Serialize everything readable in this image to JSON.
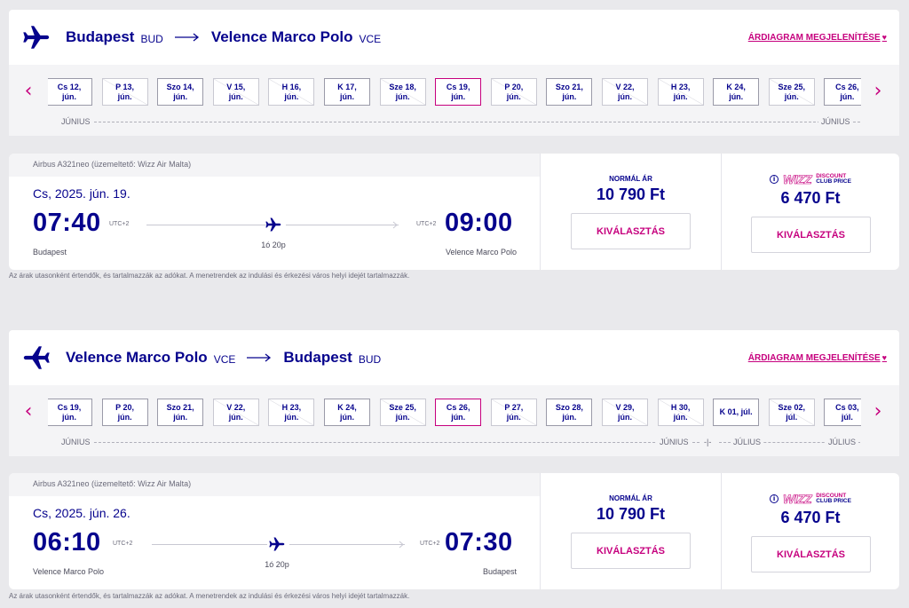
{
  "segments": [
    {
      "origin": "Budapest",
      "origin_code": "BUD",
      "destination": "Velence Marco Polo",
      "destination_code": "VCE",
      "price_chart_link": "ÁRDIAGRAM MEGJELENÍTÉSE",
      "dates": [
        {
          "day": "Cs 12,",
          "month": "jún.",
          "available": true
        },
        {
          "day": "P 13,",
          "month": "jún.",
          "available": false
        },
        {
          "day": "Szo 14,",
          "month": "jún.",
          "available": true
        },
        {
          "day": "V 15,",
          "month": "jún.",
          "available": false
        },
        {
          "day": "H 16,",
          "month": "jún.",
          "available": false
        },
        {
          "day": "K 17,",
          "month": "jún.",
          "available": true
        },
        {
          "day": "Sze 18,",
          "month": "jún.",
          "available": false
        },
        {
          "day": "Cs 19,",
          "month": "jún.",
          "available": true,
          "selected": true
        },
        {
          "day": "P 20,",
          "month": "jún.",
          "available": false
        },
        {
          "day": "Szo 21,",
          "month": "jún.",
          "available": true
        },
        {
          "day": "V 22,",
          "month": "jún.",
          "available": false
        },
        {
          "day": "H 23,",
          "month": "jún.",
          "available": false
        },
        {
          "day": "K 24,",
          "month": "jún.",
          "available": true
        },
        {
          "day": "Sze 25,",
          "month": "jún.",
          "available": false
        },
        {
          "day": "Cs 26,",
          "month": "jún.",
          "available": true
        }
      ],
      "months": {
        "left": "JÚNIUS",
        "right": "JÚNIUS"
      },
      "flight": {
        "aircraft": "Airbus A321neo (üzemeltető: Wizz Air Malta)",
        "date": "Cs, 2025. jún. 19.",
        "departure_time": "07:40",
        "arrival_time": "09:00",
        "departure_utc": "UTC+2",
        "arrival_utc": "UTC+2",
        "duration": "1ó 20p",
        "departure_city": "Budapest",
        "arrival_city": "Velence Marco Polo"
      },
      "fares": {
        "normal_label": "NORMÁL ÁR",
        "normal_price": "10 790 Ft",
        "club_price": "6 470 Ft",
        "select_label": "KIVÁLASZTÁS"
      }
    },
    {
      "origin": "Velence Marco Polo",
      "origin_code": "VCE",
      "destination": "Budapest",
      "destination_code": "BUD",
      "price_chart_link": "ÁRDIAGRAM MEGJELENÍTÉSE",
      "dates": [
        {
          "day": "Cs 19,",
          "month": "jún.",
          "available": true
        },
        {
          "day": "P 20,",
          "month": "jún.",
          "available": true
        },
        {
          "day": "Szo 21,",
          "month": "jún.",
          "available": true
        },
        {
          "day": "V 22,",
          "month": "jún.",
          "available": false
        },
        {
          "day": "H 23,",
          "month": "jún.",
          "available": false
        },
        {
          "day": "K 24,",
          "month": "jún.",
          "available": true
        },
        {
          "day": "Sze 25,",
          "month": "jún.",
          "available": false
        },
        {
          "day": "Cs 26,",
          "month": "jún.",
          "available": true,
          "selected": true
        },
        {
          "day": "P 27,",
          "month": "jún.",
          "available": false
        },
        {
          "day": "Szo 28,",
          "month": "jún.",
          "available": true
        },
        {
          "day": "V 29,",
          "month": "jún.",
          "available": false
        },
        {
          "day": "H 30,",
          "month": "jún.",
          "available": false
        },
        {
          "day": "K 01, júl.",
          "month": "",
          "available": true
        },
        {
          "day": "Sze 02,",
          "month": "júl.",
          "available": false
        },
        {
          "day": "Cs 03,",
          "month": "júl.",
          "available": true
        }
      ],
      "months": {
        "left": "JÚNIUS",
        "mid_end": "JÚNIUS",
        "mid_start": "JÚLIUS",
        "right": "JÚLIUS"
      },
      "flight": {
        "aircraft": "Airbus A321neo (üzemeltető: Wizz Air Malta)",
        "date": "Cs, 2025. jún. 26.",
        "departure_time": "06:10",
        "arrival_time": "07:30",
        "departure_utc": "UTC+2",
        "arrival_utc": "UTC+2",
        "duration": "1ó 20p",
        "departure_city": "Velence Marco Polo",
        "arrival_city": "Budapest"
      },
      "fares": {
        "normal_label": "NORMÁL ÁR",
        "normal_price": "10 790 Ft",
        "club_price": "6 470 Ft",
        "select_label": "KIVÁLASZTÁS"
      }
    }
  ],
  "club_badge": {
    "logo": "WIZZ",
    "line1": "DISCOUNT",
    "line2": "CLUB PRICE",
    "info_glyph": "i"
  },
  "nav": {
    "prev_glyph": "‹",
    "next_glyph": "›"
  },
  "heart_glyph": "♥",
  "disclaimer": "Az árak utasonként értendők, és tartalmazzák az adókat. A menetrendek az indulási és érkezési város helyi idejét tartalmazzák.",
  "colors": {
    "navy": "#06038d",
    "magenta": "#c6007e",
    "background": "#e9e9ec"
  },
  "icons": [
    "airplane-icon",
    "arrow-right-icon",
    "heart-icon",
    "chevron-left-icon",
    "chevron-right-icon",
    "info-icon"
  ]
}
